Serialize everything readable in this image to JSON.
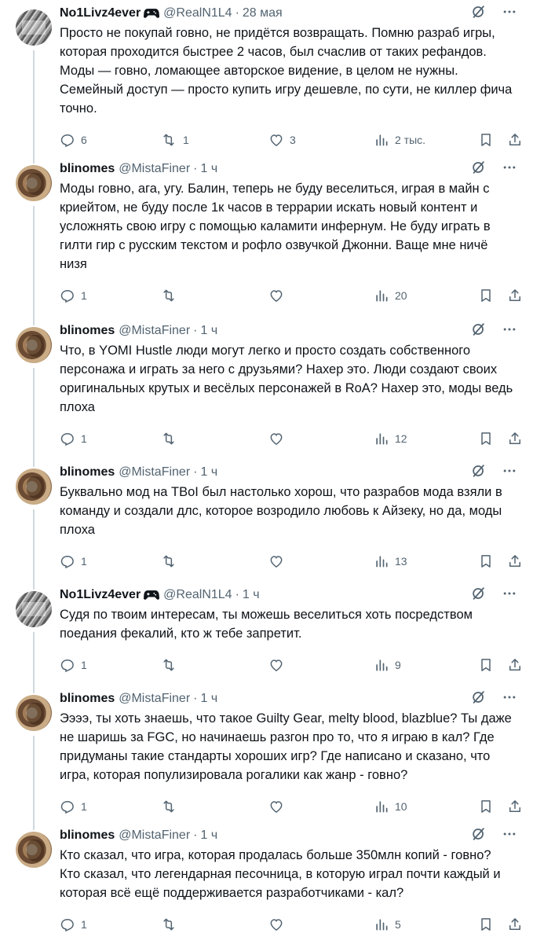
{
  "tweets": [
    {
      "name": "No1Livz4ever",
      "gamepad": true,
      "handle": "@RealN1L4",
      "time": "28 мая",
      "avatar": "nol",
      "lines": [
        "Просто не покупай говно, не придётся возвращать. Помню разраб игры,",
        "которая проходится быстрее 2 часов, был счаслив от таких рефандов.",
        "Моды — говно, ломающее авторское видение, в целом не нужны.",
        "Семейный доступ — просто купить игру дешевле, по сути, не киллер фича",
        "точно."
      ],
      "replies": "6",
      "retweets": "1",
      "likes": "3",
      "views": "2 тыс."
    },
    {
      "name": "blinomes",
      "gamepad": false,
      "handle": "@MistaFiner",
      "time": "1 ч",
      "avatar": "blin",
      "lines": [
        "Моды говно, ага, угу. Балин, теперь не буду веселиться, играя в майн с",
        "криейтом, не буду после 1к часов в террарии искать новый контент и",
        "усложнять свою игру с помощью каламити инфернум. Не буду играть в",
        "гилти гир с русским текстом и рофло озвучкой Джонни. Ваще мне ничё",
        "низя"
      ],
      "replies": "1",
      "retweets": "",
      "likes": "",
      "views": "20"
    },
    {
      "name": "blinomes",
      "gamepad": false,
      "handle": "@MistaFiner",
      "time": "1 ч",
      "avatar": "blin",
      "lines": [
        "Что, в YOMI Hustle люди могут легко и просто создать собственного",
        "персонажа и играть за него с друзьями? Нахер это. Люди создают своих",
        "оригинальных крутых и весёлых персонажей в RoA? Нахер это, моды ведь",
        "плоха"
      ],
      "replies": "1",
      "retweets": "",
      "likes": "",
      "views": "12"
    },
    {
      "name": "blinomes",
      "gamepad": false,
      "handle": "@MistaFiner",
      "time": "1 ч",
      "avatar": "blin",
      "lines": [
        "Буквально мод на TBoI был настолько хорош, что разрабов мода взяли в",
        "команду и создали длс, которое возродило любовь к Айзеку, но да, моды",
        "плоха"
      ],
      "replies": "1",
      "retweets": "",
      "likes": "",
      "views": "13"
    },
    {
      "name": "No1Livz4ever",
      "gamepad": true,
      "handle": "@RealN1L4",
      "time": "1 ч",
      "avatar": "nol",
      "lines": [
        "Судя по твоим интересам, ты можешь веселиться хоть посредством",
        "поедания фекалий, кто ж тебе запретит."
      ],
      "replies": "1",
      "retweets": "",
      "likes": "",
      "views": "9"
    },
    {
      "name": "blinomes",
      "gamepad": false,
      "handle": "@MistaFiner",
      "time": "1 ч",
      "avatar": "blin",
      "lines": [
        "Ээээ, ты хоть знаешь, что такое Guilty Gear, melty blood, blazblue? Ты даже",
        "не шаришь за FGC, но начинаешь разгон про то, что я играю в кал? Где",
        "придуманы такие стандарты хороших игр? Где написано и сказано, что",
        "игра, которая популизировала рогалики как жанр - говно?"
      ],
      "replies": "1",
      "retweets": "",
      "likes": "",
      "views": "10"
    },
    {
      "name": "blinomes",
      "gamepad": false,
      "handle": "@MistaFiner",
      "time": "1 ч",
      "avatar": "blin",
      "lines": [
        "Кто сказал, что игра, которая продалась больше 350млн копий - говно?",
        "Кто сказал, что легендарная песочница, в которую играл почти каждый и",
        "которая всё ещё поддерживается разработчиками - кал?"
      ],
      "replies": "1",
      "retweets": "",
      "likes": "",
      "views": "5"
    }
  ],
  "colors": {
    "text": "#0f1419",
    "secondary": "#536471",
    "thread_line": "#cfd9de",
    "divider": "#eff3f4"
  }
}
